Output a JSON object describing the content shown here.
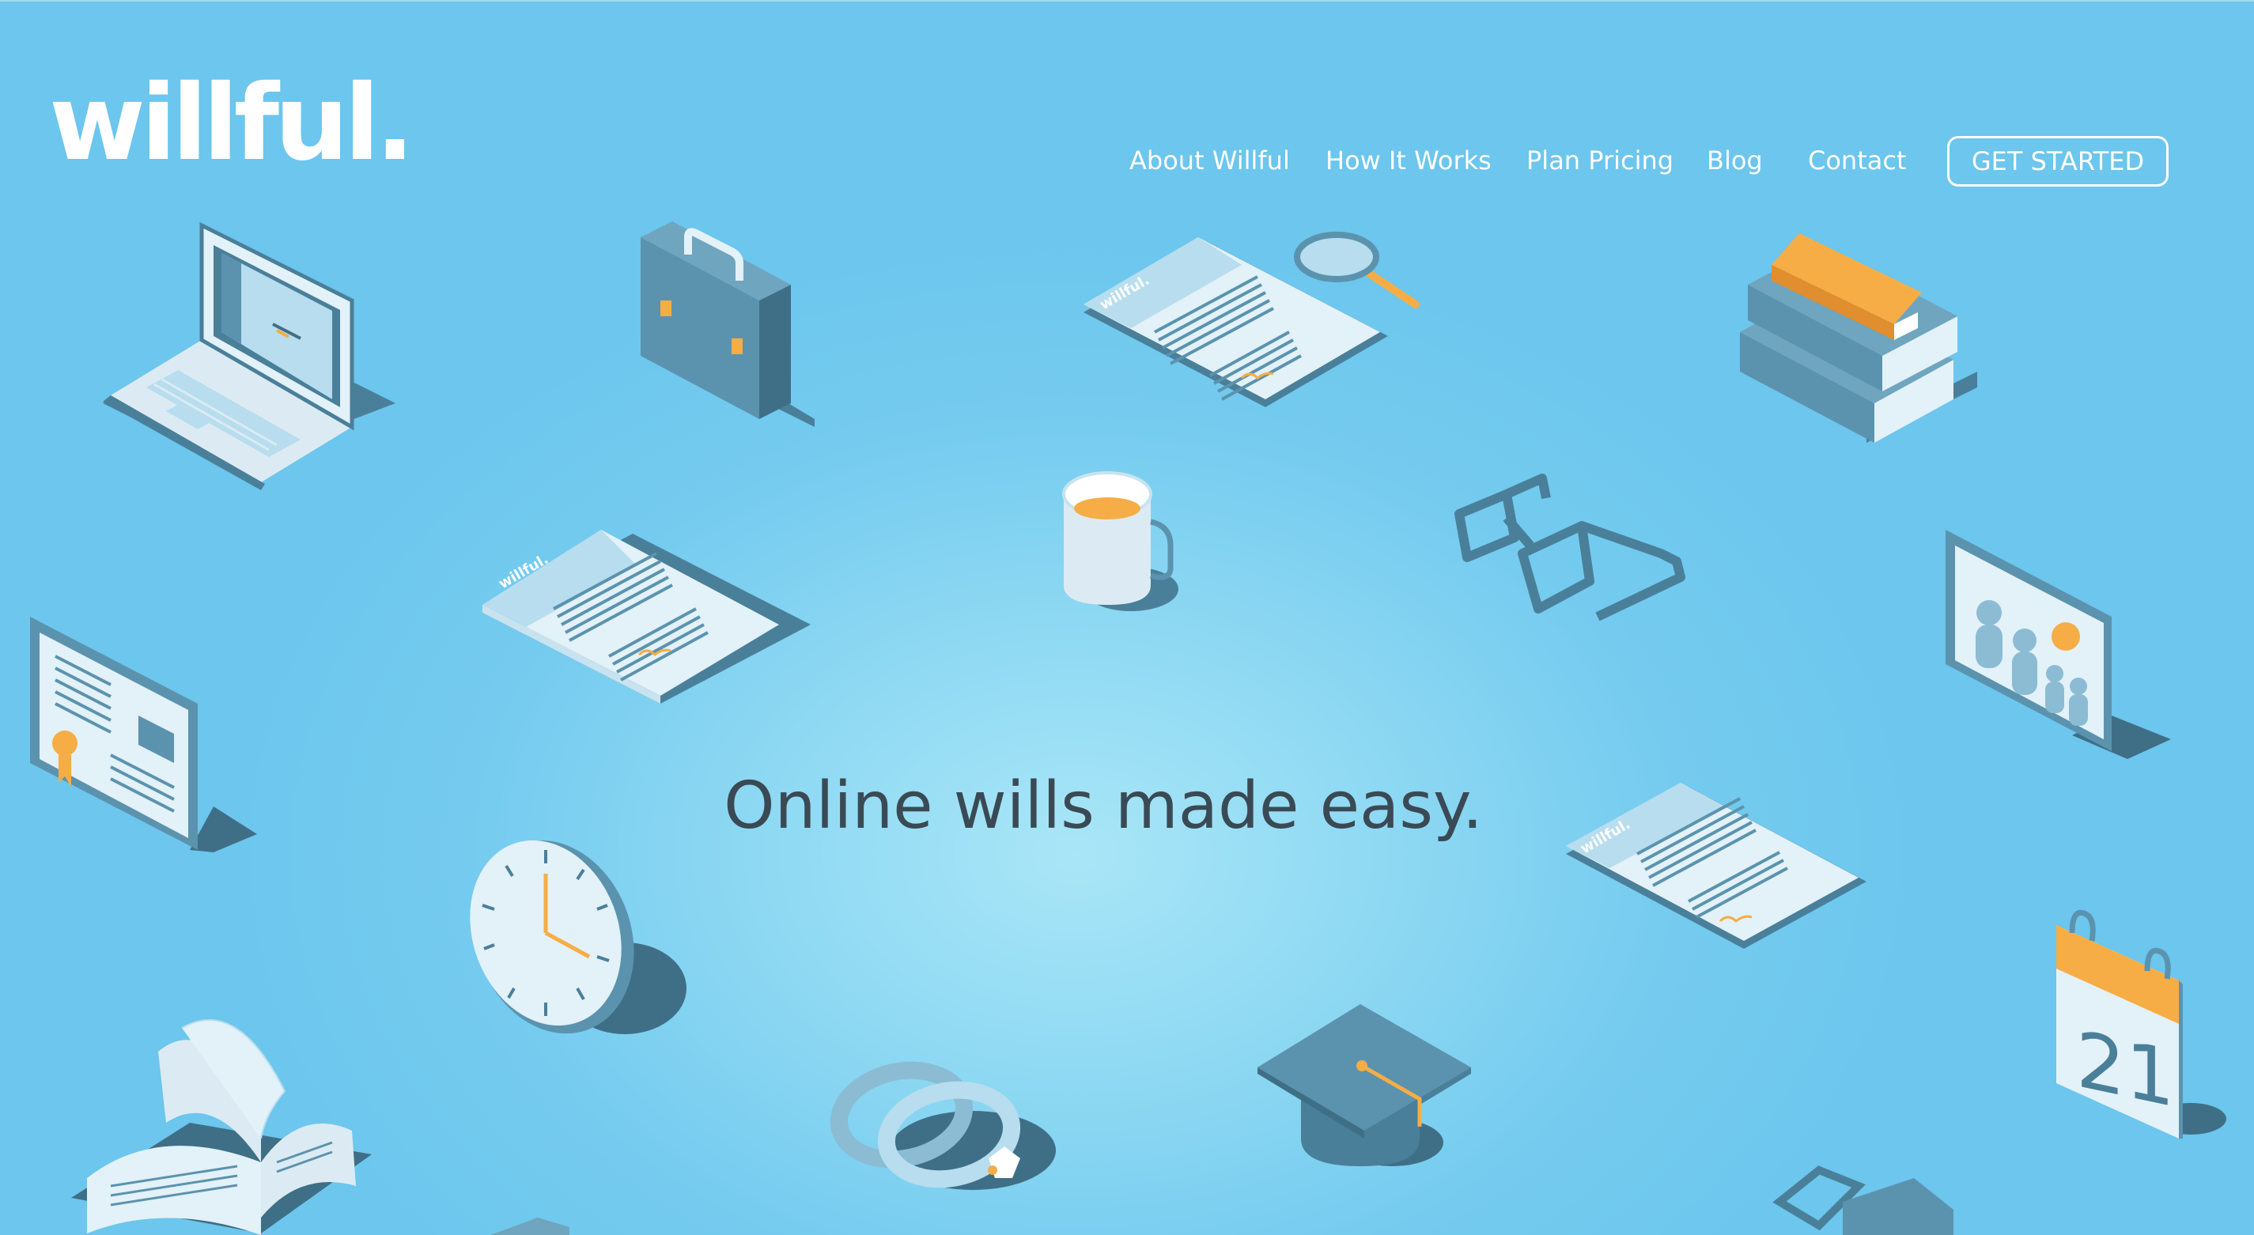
{
  "brand": {
    "logo_text": "willful."
  },
  "nav": {
    "items": [
      {
        "label": "About Willful"
      },
      {
        "label": "How It Works"
      },
      {
        "label": "Plan Pricing"
      },
      {
        "label": "Blog"
      },
      {
        "label": "Contact"
      }
    ],
    "cta_label": "GET STARTED"
  },
  "hero": {
    "headline": "Online wills made easy."
  },
  "illustrations": {
    "doc_logo_text": "willful.",
    "calendar_day": "21",
    "icons": [
      "laptop-icon",
      "briefcase-icon",
      "document-icon",
      "magnifier-icon",
      "books-icon",
      "mug-icon",
      "glasses-icon",
      "family-photo-icon",
      "certificate-icon",
      "clock-icon",
      "calendar-icon",
      "graduation-cap-icon",
      "rings-icon",
      "open-book-icon"
    ]
  },
  "colors": {
    "background": "#6cc6ed",
    "background_center": "#a9e6f7",
    "illustration_dark": "#4a7f9a",
    "illustration_mid": "#5b93ae",
    "illustration_light": "#e3f1f8",
    "accent_orange": "#f6ad45",
    "text_dark": "#3a4a55",
    "white": "#ffffff"
  }
}
